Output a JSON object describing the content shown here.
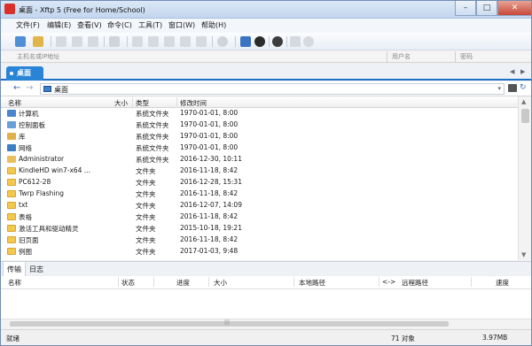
{
  "window": {
    "title": "桌面 - Xftp 5 (Free for Home/School)",
    "controls": [
      "–",
      "□",
      "✕"
    ]
  },
  "menu": [
    "文件(F)",
    "编辑(E)",
    "查看(V)",
    "命令(C)",
    "工具(T)",
    "窗口(W)",
    "帮助(H)"
  ],
  "address": {
    "host_placeholder": "主机名或IP地址",
    "user_placeholder": "用户名",
    "password_placeholder": "密码"
  },
  "tabs": {
    "active": "桌面"
  },
  "path": {
    "current": "桌面"
  },
  "file_columns": [
    "名称",
    "大小",
    "类型",
    "修改时间"
  ],
  "files": [
    {
      "name": "计算机",
      "size": "",
      "type": "系统文件夹",
      "modified": "1970-01-01, 8:00",
      "icon": "computer-icon"
    },
    {
      "name": "控制面板",
      "size": "",
      "type": "系统文件夹",
      "modified": "1970-01-01, 8:00",
      "icon": "control-panel-icon"
    },
    {
      "name": "库",
      "size": "",
      "type": "系统文件夹",
      "modified": "1970-01-01, 8:00",
      "icon": "library-icon"
    },
    {
      "name": "网络",
      "size": "",
      "type": "系统文件夹",
      "modified": "1970-01-01, 8:00",
      "icon": "network-icon"
    },
    {
      "name": "Administrator",
      "size": "",
      "type": "系统文件夹",
      "modified": "2016-12-30, 10:11",
      "icon": "user-folder-icon"
    },
    {
      "name": "KindleHD win7-x64 ...",
      "size": "",
      "type": "文件夹",
      "modified": "2016-11-18, 8:42",
      "icon": "folder-icon"
    },
    {
      "name": "PC612-28",
      "size": "",
      "type": "文件夹",
      "modified": "2016-12-28, 15:31",
      "icon": "folder-icon"
    },
    {
      "name": "Twrp Flashing",
      "size": "",
      "type": "文件夹",
      "modified": "2016-11-18, 8:42",
      "icon": "folder-icon"
    },
    {
      "name": "txt",
      "size": "",
      "type": "文件夹",
      "modified": "2016-12-07, 14:09",
      "icon": "folder-icon"
    },
    {
      "name": "表格",
      "size": "",
      "type": "文件夹",
      "modified": "2016-11-18, 8:42",
      "icon": "folder-icon"
    },
    {
      "name": "激活工具和驱动精灵",
      "size": "",
      "type": "文件夹",
      "modified": "2015-10-18, 19:21",
      "icon": "folder-icon"
    },
    {
      "name": "旧页面",
      "size": "",
      "type": "文件夹",
      "modified": "2016-11-18, 8:42",
      "icon": "folder-icon"
    },
    {
      "name": "例图",
      "size": "",
      "type": "文件夹",
      "modified": "2017-01-03, 9:48",
      "icon": "folder-icon"
    }
  ],
  "transfer_tabs": [
    "传输",
    "日志"
  ],
  "transfer_columns": [
    "名称",
    "状态",
    "进度",
    "大小",
    "本地路径",
    "<->",
    "远程路径",
    "速度"
  ],
  "status": {
    "left": "就绪",
    "count": "71 对象",
    "size": "3.97MB"
  },
  "colors": {
    "accent": "#2a84d6",
    "folder": "#f3c84e",
    "close": "#c7483a"
  }
}
